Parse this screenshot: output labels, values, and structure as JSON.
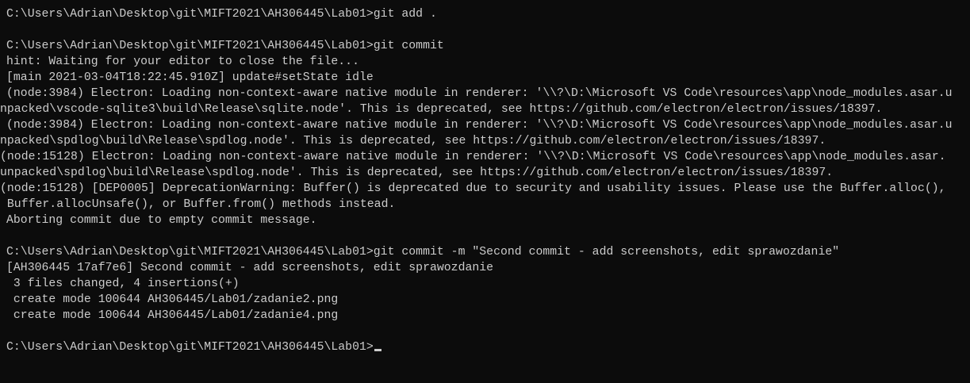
{
  "terminal": {
    "lines": [
      "C:\\Users\\Adrian\\Desktop\\git\\MIFT2021\\AH306445\\Lab01>git add .",
      "",
      "C:\\Users\\Adrian\\Desktop\\git\\MIFT2021\\AH306445\\Lab01>git commit",
      "hint: Waiting for your editor to close the file...",
      "[main 2021-03-04T18:22:45.910Z] update#setState idle",
      "(node:3984) Electron: Loading non-context-aware native module in renderer: '\\\\?\\D:\\Microsoft VS Code\\resources\\app\\node_modules.asar.u",
      "npacked\\vscode-sqlite3\\build\\Release\\sqlite.node'. This is deprecated, see https://github.com/electron/electron/issues/18397.",
      "(node:3984) Electron: Loading non-context-aware native module in renderer: '\\\\?\\D:\\Microsoft VS Code\\resources\\app\\node_modules.asar.u",
      "npacked\\spdlog\\build\\Release\\spdlog.node'. This is deprecated, see https://github.com/electron/electron/issues/18397.",
      "(node:15128) Electron: Loading non-context-aware native module in renderer: '\\\\?\\D:\\Microsoft VS Code\\resources\\app\\node_modules.asar.",
      "unpacked\\spdlog\\build\\Release\\spdlog.node'. This is deprecated, see https://github.com/electron/electron/issues/18397.",
      "(node:15128) [DEP0005] DeprecationWarning: Buffer() is deprecated due to security and usability issues. Please use the Buffer.alloc(),",
      " Buffer.allocUnsafe(), or Buffer.from() methods instead.",
      "Aborting commit due to empty commit message.",
      "",
      "C:\\Users\\Adrian\\Desktop\\git\\MIFT2021\\AH306445\\Lab01>git commit -m \"Second commit - add screenshots, edit sprawozdanie\"",
      "[AH306445 17af7e6] Second commit - add screenshots, edit sprawozdanie",
      " 3 files changed, 4 insertions(+)",
      " create mode 100644 AH306445/Lab01/zadanie2.png",
      " create mode 100644 AH306445/Lab01/zadanie4.png",
      "",
      "C:\\Users\\Adrian\\Desktop\\git\\MIFT2021\\AH306445\\Lab01>"
    ]
  },
  "colors": {
    "background": "#0c0c0c",
    "foreground": "#cccccc"
  }
}
